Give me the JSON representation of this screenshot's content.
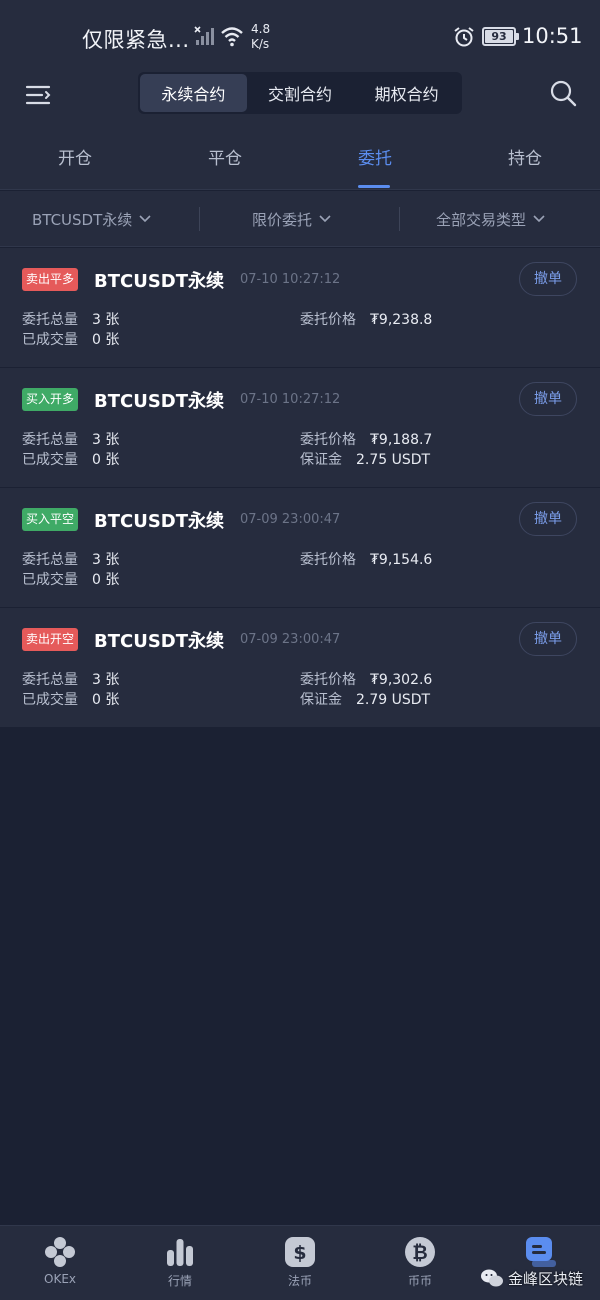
{
  "status_bar": {
    "notification": "仅限紧急...",
    "speed": "4.8",
    "speed_unit": "K/s",
    "battery": "93",
    "time": "10:51"
  },
  "header": {
    "segments": [
      "永续合约",
      "交割合约",
      "期权合约"
    ],
    "active_segment": "永续合约"
  },
  "subtabs": {
    "items": [
      "开仓",
      "平仓",
      "委托",
      "持仓"
    ],
    "active": "委托"
  },
  "filters": {
    "symbol": "BTCUSDT永续",
    "order_type": "限价委托",
    "trade_type": "全部交易类型"
  },
  "labels": {
    "total": "委托总量",
    "filled": "已成交量",
    "price": "委托价格",
    "margin": "保证金",
    "cancel": "撤单"
  },
  "orders": [
    {
      "badge": "卖出平多",
      "badge_color": "#e55a5a",
      "name": "BTCUSDT永续",
      "time": "07-10 10:27:12",
      "total": "3 张",
      "filled": "0 张",
      "price": "₮9,238.8"
    },
    {
      "badge": "买入开多",
      "badge_color": "#3faa66",
      "name": "BTCUSDT永续",
      "time": "07-10 10:27:12",
      "total": "3 张",
      "filled": "0 张",
      "price": "₮9,188.7",
      "margin": "2.75 USDT"
    },
    {
      "badge": "买入平空",
      "badge_color": "#3faa66",
      "name": "BTCUSDT永续",
      "time": "07-09 23:00:47",
      "total": "3 张",
      "filled": "0 张",
      "price": "₮9,154.6"
    },
    {
      "badge": "卖出开空",
      "badge_color": "#e55a5a",
      "name": "BTCUSDT永续",
      "time": "07-09 23:00:47",
      "total": "3 张",
      "filled": "0 张",
      "price": "₮9,302.6",
      "margin": "2.79 USDT"
    }
  ],
  "bottom_nav": {
    "items": [
      {
        "label": "OKEx",
        "icon": "okex-logo-icon"
      },
      {
        "label": "行情",
        "icon": "market-bars-icon"
      },
      {
        "label": "法币",
        "icon": "fiat-dollar-icon"
      },
      {
        "label": "币币",
        "icon": "coin-bitcoin-icon"
      },
      {
        "label": "",
        "icon": "contract-icon"
      }
    ],
    "accent": "#5b8def"
  },
  "watermark": {
    "text": "金峰区块链"
  }
}
